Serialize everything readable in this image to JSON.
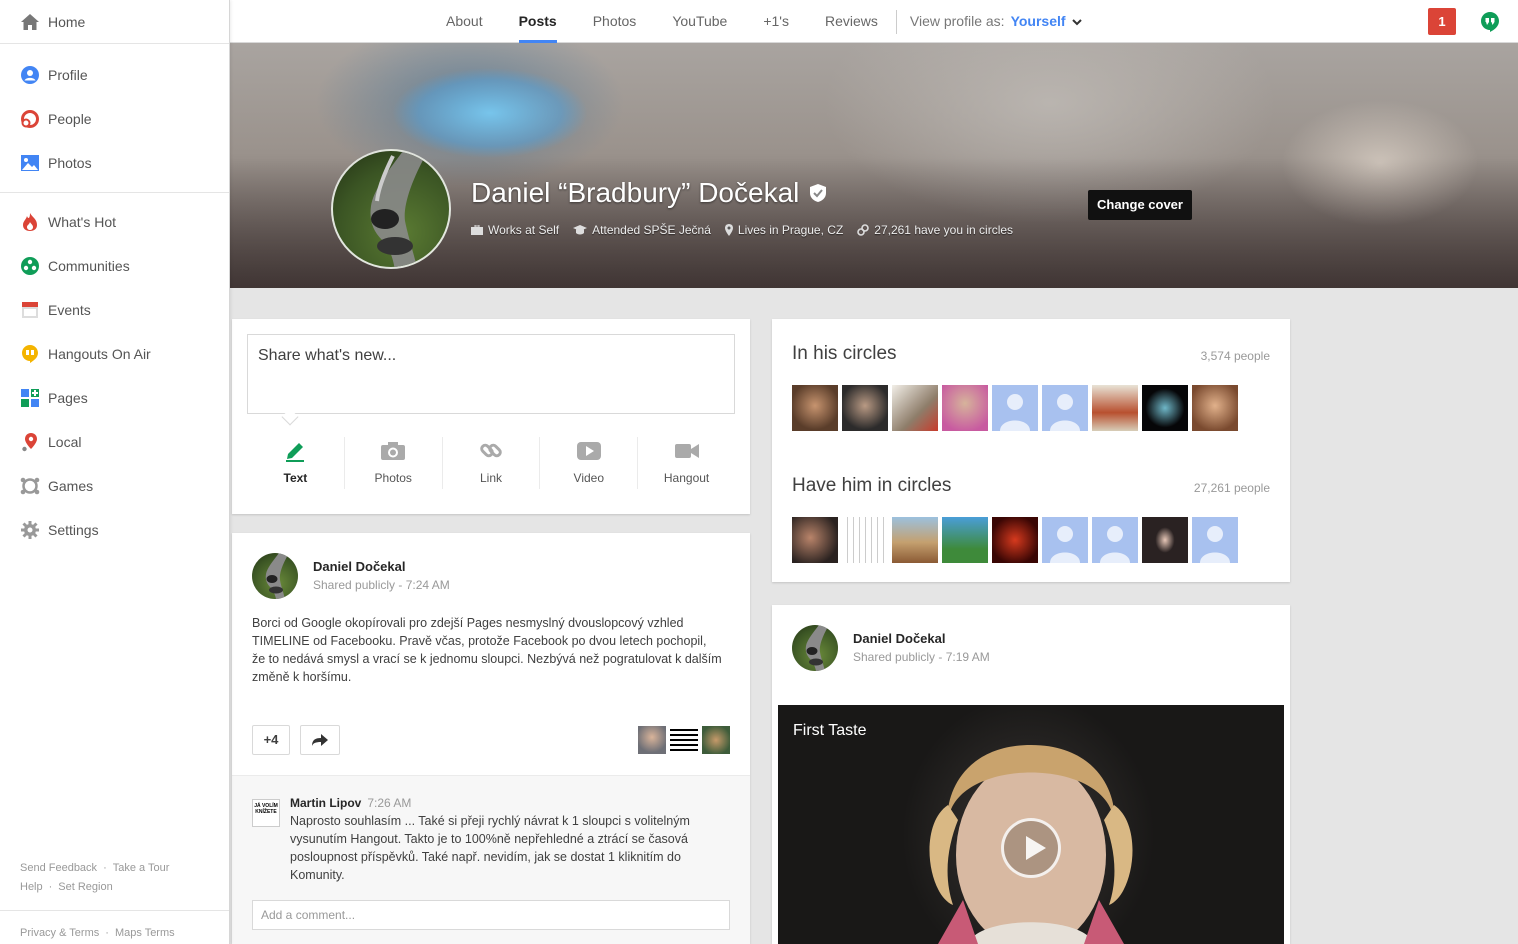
{
  "nav": {
    "home": "Home",
    "group1": [
      "Profile",
      "People",
      "Photos"
    ],
    "group2": [
      "What's Hot",
      "Communities",
      "Events",
      "Hangouts On Air",
      "Pages",
      "Local",
      "Games",
      "Settings"
    ],
    "footer": {
      "send_feedback": "Send Feedback",
      "take_tour": "Take a Tour",
      "help": "Help",
      "set_region": "Set Region",
      "privacy": "Privacy & Terms",
      "maps_terms": "Maps Terms"
    }
  },
  "topbar": {
    "tabs": [
      "About",
      "Posts",
      "Photos",
      "YouTube",
      "+1's",
      "Reviews"
    ],
    "active_tab": "Posts",
    "view_as_label": "View profile as:",
    "view_as_value": "Yourself",
    "notification_count": "1"
  },
  "cover": {
    "name": "Daniel “Bradbury” Dočekal",
    "works": "Works at Self",
    "attended": "Attended SPŠE Ječná",
    "lives": "Lives in Prague, CZ",
    "circled": "27,261 have you in circles",
    "change_cover": "Change cover"
  },
  "share": {
    "placeholder": "Share what's new...",
    "actions": [
      "Text",
      "Photos",
      "Link",
      "Video",
      "Hangout"
    ]
  },
  "post1": {
    "author": "Daniel Dočekal",
    "visibility": "Shared publicly",
    "time": "7:24 AM",
    "text": "Borci od Google okopírovali pro zdejší Pages nesmyslný dvouslopcový vzhled TIMELINE od Facebooku. Pravě včas, protože Facebook po dvou letech pochopil, že to nedává smysl a vrací se k jednomu sloupci. Nezbývá než pogratulovat k dalším změně k horšímu.",
    "plus_count": "+4",
    "comment": {
      "author": "Martin Lipov",
      "time": "7:26 AM",
      "avatar_text": "JÁ VOLÍM KNÍŽETE",
      "text": "Naprosto souhlasím ... Také si přeji rychlý návrat k 1 sloupci s volitelným vysunutím Hangout.  Takto je to 100%ně nepřehledné a ztrácí se časová posloupnost příspěvků. Také např. nevidím, jak se dostat 1 kliknitím do Komunity."
    },
    "add_comment": "Add a comment..."
  },
  "circles": {
    "in_title": "In his circles",
    "in_count": "3,574 people",
    "have_title": "Have him in circles",
    "have_count": "27,261 people"
  },
  "post2": {
    "author": "Daniel Dočekal",
    "visibility": "Shared publicly",
    "time": "7:19 AM",
    "video_title": "First Taste"
  },
  "colors": {
    "accent": "#4285f4",
    "notification": "#db4437",
    "hangouts": "#0f9d58"
  }
}
